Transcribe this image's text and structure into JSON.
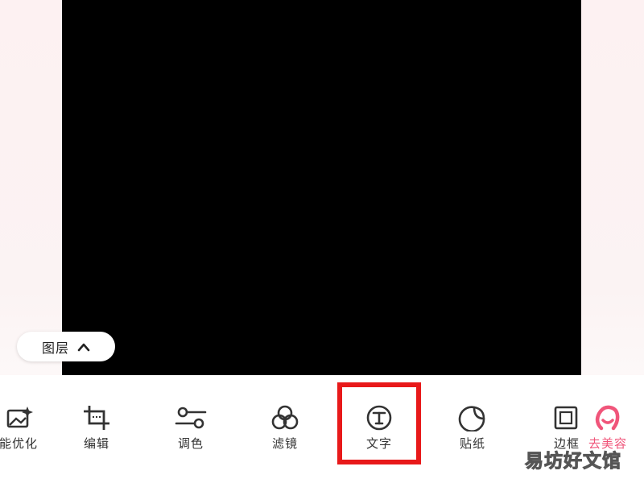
{
  "layer_button": {
    "label": "图层",
    "icon": "chevron-up-icon"
  },
  "toolbar": {
    "items": [
      {
        "id": "auto-optimize",
        "label": "能优化",
        "icon": "image-sparkle-icon"
      },
      {
        "id": "edit",
        "label": "编辑",
        "icon": "crop-icon"
      },
      {
        "id": "adjust",
        "label": "调色",
        "icon": "sliders-icon"
      },
      {
        "id": "filter",
        "label": "滤镜",
        "icon": "circles-icon"
      },
      {
        "id": "text",
        "label": "文字",
        "icon": "text-circle-icon",
        "highlighted": true
      },
      {
        "id": "sticker",
        "label": "贴纸",
        "icon": "sticker-icon"
      },
      {
        "id": "border",
        "label": "边框",
        "icon": "frame-icon"
      },
      {
        "id": "beautify",
        "label": "去美容",
        "icon": "beauty-logo-icon",
        "accent_color": "#f0557a"
      }
    ]
  },
  "highlight_color": "#e8191a",
  "watermark": {
    "text": "易坊好文馆"
  }
}
